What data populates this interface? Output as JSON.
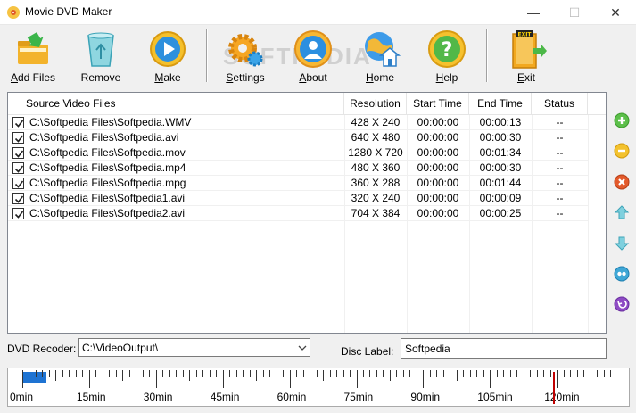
{
  "window": {
    "title": "Movie DVD Maker",
    "min_glyph": "—",
    "max_glyph": "☐",
    "close_glyph": "✕"
  },
  "toolbar": {
    "add_files": {
      "prefix": "A",
      "rest": "dd Files"
    },
    "remove": {
      "prefix": "",
      "rest": "Remove"
    },
    "make": {
      "prefix": "M",
      "rest": "ake"
    },
    "settings": {
      "prefix": "S",
      "rest": "ettings"
    },
    "about": {
      "prefix": "A",
      "rest": "bout"
    },
    "home": {
      "prefix": "H",
      "rest": "ome"
    },
    "help": {
      "prefix": "H",
      "rest": "elp"
    },
    "exit": {
      "prefix": "E",
      "rest": "xit"
    },
    "exit_sign": "EXIT",
    "watermark": "SOFTPEDIA"
  },
  "list": {
    "columns": [
      "Source Video Files",
      "Resolution",
      "Start Time",
      "End Time",
      "Status"
    ],
    "rows": [
      {
        "file": "C:\\Softpedia Files\\Softpedia.WMV",
        "resolution": "428 X 240",
        "start": "00:00:00",
        "end": "00:00:13",
        "status": "--",
        "checked": true
      },
      {
        "file": "C:\\Softpedia Files\\Softpedia.avi",
        "resolution": "640 X 480",
        "start": "00:00:00",
        "end": "00:00:30",
        "status": "--",
        "checked": true
      },
      {
        "file": "C:\\Softpedia Files\\Softpedia.mov",
        "resolution": "1280 X 720",
        "start": "00:00:00",
        "end": "00:01:34",
        "status": "--",
        "checked": true
      },
      {
        "file": "C:\\Softpedia Files\\Softpedia.mp4",
        "resolution": "480 X 360",
        "start": "00:00:00",
        "end": "00:00:30",
        "status": "--",
        "checked": true
      },
      {
        "file": "C:\\Softpedia Files\\Softpedia.mpg",
        "resolution": "360 X 288",
        "start": "00:00:00",
        "end": "00:01:44",
        "status": "--",
        "checked": true
      },
      {
        "file": "C:\\Softpedia Files\\Softpedia1.avi",
        "resolution": "320 X 240",
        "start": "00:00:00",
        "end": "00:00:09",
        "status": "--",
        "checked": true
      },
      {
        "file": "C:\\Softpedia Files\\Softpedia2.avi",
        "resolution": "704 X 384",
        "start": "00:00:00",
        "end": "00:00:25",
        "status": "--",
        "checked": true
      }
    ]
  },
  "side_buttons": [
    "add-icon",
    "remove-icon",
    "delete-icon",
    "move-up-icon",
    "move-down-icon",
    "info-icon",
    "back-icon"
  ],
  "bottom": {
    "dvd_recorder_label": "DVD Recoder:",
    "dvd_recorder_value": "C:\\VideoOutput\\",
    "disc_label_label": "Disc Label:",
    "disc_label_value": "Softpedia"
  },
  "timeline": {
    "labels": [
      "0min",
      "15min",
      "30min",
      "45min",
      "60min",
      "75min",
      "90min",
      "105min",
      "120min"
    ],
    "used_fraction": 0.04,
    "capacity_marker_min": 120
  }
}
